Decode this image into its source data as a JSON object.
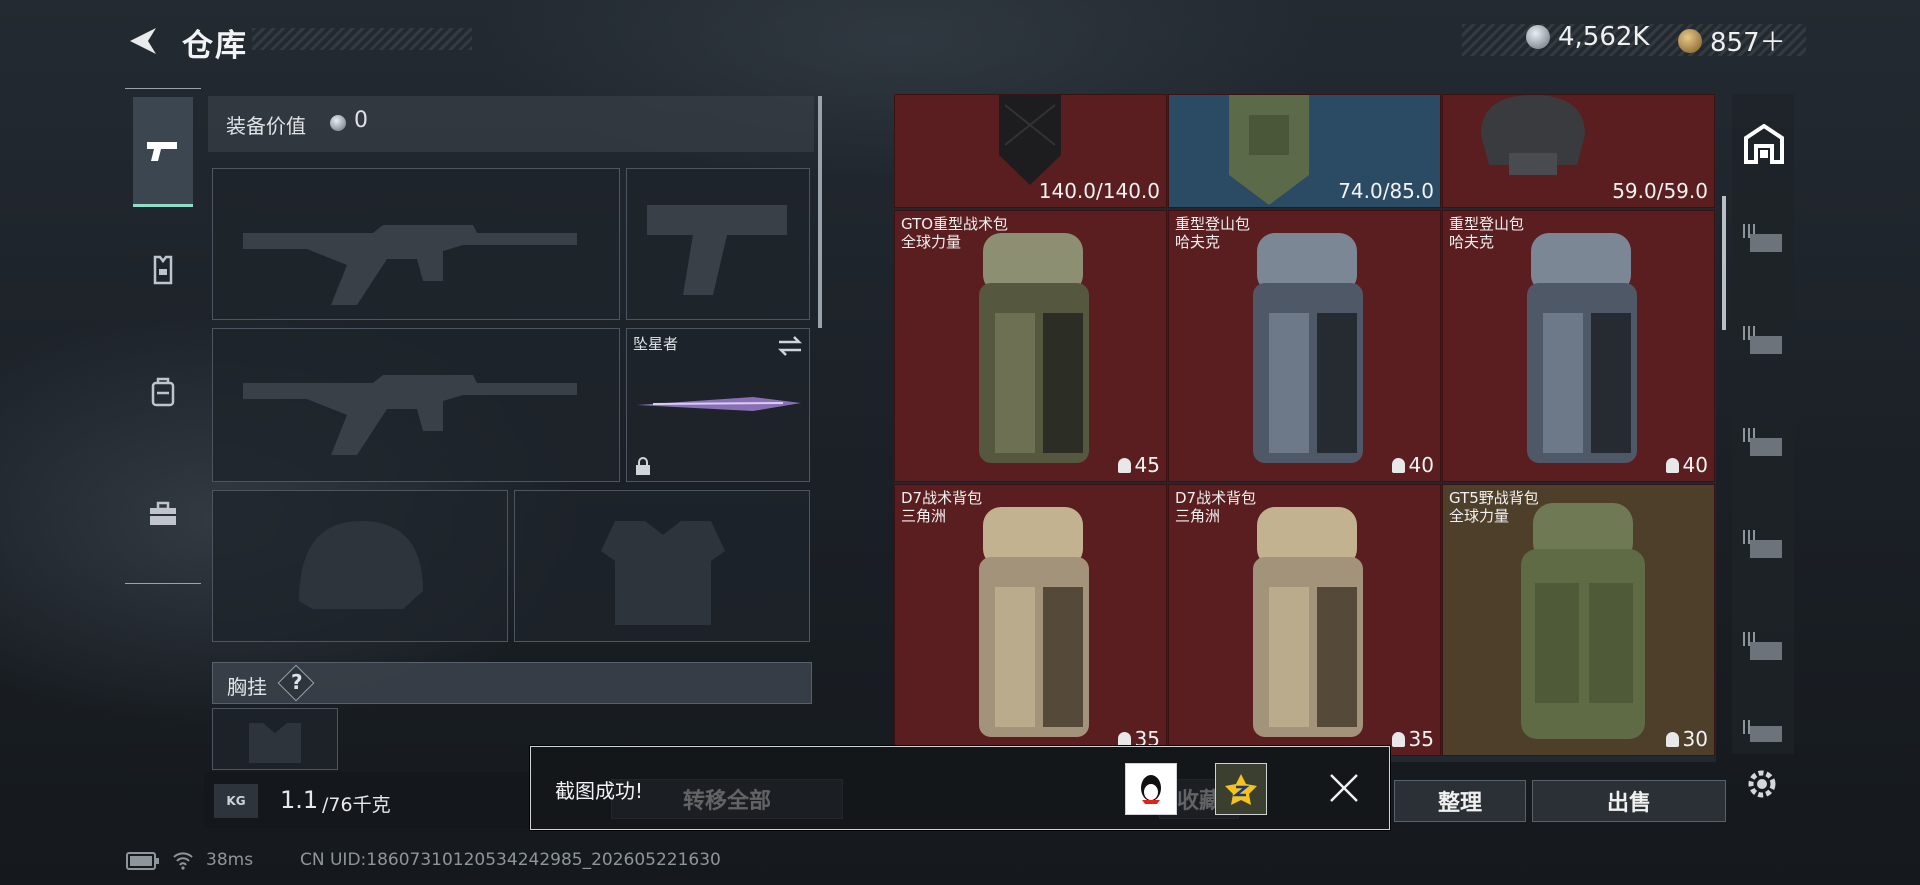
{
  "header": {
    "title": "仓库",
    "silver": "4,562K",
    "gold": "857＋"
  },
  "equip": {
    "value_label": "装备价值",
    "value": "0",
    "knife_name": "坠星者",
    "chest_label": "胸挂",
    "help": "?"
  },
  "weight": {
    "current": "1.1",
    "max": "/76千克",
    "kg": "KG"
  },
  "grid": {
    "top": [
      {
        "durability": "140.0/140.0"
      },
      {
        "durability": "74.0/85.0"
      },
      {
        "durability": "59.0/59.0"
      }
    ],
    "items": [
      {
        "name": "GTO重型战术包",
        "sub": "全球力量",
        "count": "45"
      },
      {
        "name": "重型登山包",
        "sub": "哈夫克",
        "count": "40"
      },
      {
        "name": "重型登山包",
        "sub": "哈夫克",
        "count": "40"
      },
      {
        "name": "D7战术背包",
        "sub": "三角洲",
        "count": "35"
      },
      {
        "name": "D7战术背包",
        "sub": "三角洲",
        "count": "35"
      },
      {
        "name": "GT5野战背包",
        "sub": "全球力量",
        "count": "30"
      }
    ]
  },
  "buttons": {
    "transfer_all": "转移全部",
    "collect": "收藏",
    "organize": "整理",
    "sell": "出售"
  },
  "toast": {
    "message": "截图成功!"
  },
  "status": {
    "ping": "38ms",
    "uid": "CN UID:18607310120534242985_202605221630"
  }
}
